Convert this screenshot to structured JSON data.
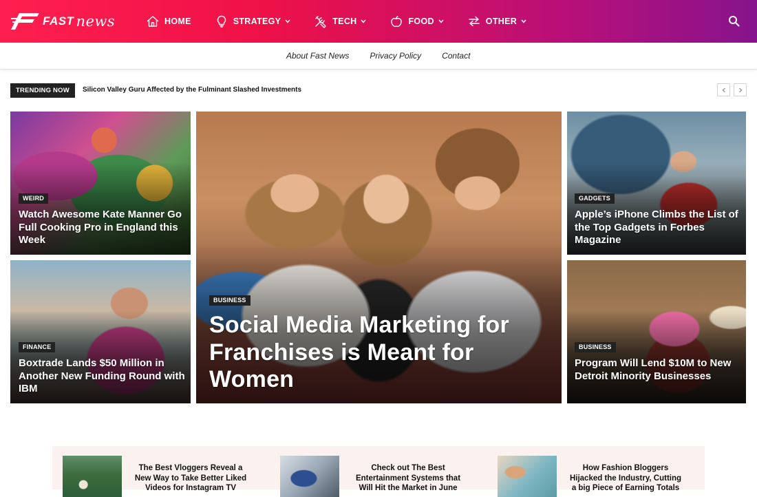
{
  "header": {
    "logo_fast": "FAST",
    "logo_news": "news",
    "nav": [
      {
        "label": "HOME",
        "icon": "home-icon",
        "dropdown": false
      },
      {
        "label": "STRATEGY",
        "icon": "lightbulb-icon",
        "dropdown": true
      },
      {
        "label": "TECH",
        "icon": "tools-icon",
        "dropdown": true
      },
      {
        "label": "FOOD",
        "icon": "apple-icon",
        "dropdown": true
      },
      {
        "label": "OTHER",
        "icon": "swap-arrows-icon",
        "dropdown": true
      }
    ],
    "search_icon": "search-icon"
  },
  "subnav": {
    "links": [
      "About Fast News",
      "Privacy Policy",
      "Contact"
    ]
  },
  "trending": {
    "badge": "TRENDING NOW",
    "headline": "Silicon Valley Guru Affected by the Fulminant Slashed Investments"
  },
  "grid": {
    "tiles": [
      {
        "category": "WEIRD",
        "title": "Watch Awesome Kate Manner Go Full Cooking Pro in England this Week"
      },
      {
        "category": "FINANCE",
        "title": "Boxtrade Lands $50 Million in Another New Funding Round with IBM"
      },
      {
        "category": "BUSINESS",
        "title": "Social Media Marketing for Franchises is Meant for Women"
      },
      {
        "category": "GADGETS",
        "title": "Apple’s iPhone Climbs the List of the Top Gadgets in Forbes Magazine"
      },
      {
        "category": "BUSINESS",
        "title": "Program Will Lend $10M to New Detroit Minority Businesses"
      }
    ]
  },
  "strip": {
    "items": [
      {
        "title": "The Best Vloggers Reveal a New Way to Take Better Liked Videos for Instagram TV"
      },
      {
        "title": "Check out The Best Entertainment Systems that Will Hit the Market in June"
      },
      {
        "title": "How Fashion Bloggers Hijacked the Industry, Cutting a big Piece of Earning Totals"
      }
    ]
  },
  "colors": {
    "header_start": "#ff1f4f",
    "header_end": "#86148c",
    "badge": "#222222",
    "strip_bg": "#fbf1ee"
  }
}
